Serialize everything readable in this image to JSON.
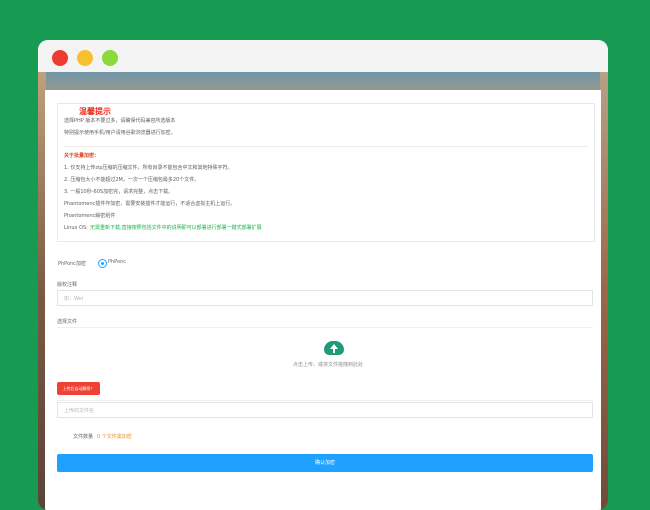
{
  "window": {
    "controls": {
      "close": "close-icon",
      "minimize": "minimize-icon",
      "zoom": "zoom-icon"
    }
  },
  "notice": {
    "title": "温馨提示",
    "intro": [
      "选择PHP 版本不要过多，请确保代码兼容所选版本",
      "特别提示使用手机/用户请用谷歌浏览器进行加密。"
    ],
    "about_title": "关于批量加密：",
    "items": [
      "1. 仅支持上传zip压缩的压缩文件，所有目录不能包含中文和其他特殊字符。",
      "2. 压缩包大小不能超过2M，一次一个压缩包最多20个文件。",
      "3. 一般10秒-60S加密完，请求完整，点击下载。",
      "Phantomenc插件作加密，需要安装插件才能运行，不适合虚拟主机上运行。",
      "Phantomenc解密组件"
    ],
    "linux_label": "Linux OS:",
    "linux_text": "无需重新下载,直接按照包括文件中的说明即可以部署进行部署一键式部署扩展"
  },
  "form": {
    "encrypt_label": "PhPonc加密",
    "encrypt_option": "PhPonc",
    "remark_label": "版权注释",
    "remark_placeholder": "如：Wei",
    "file_label": "选择文件",
    "upload_hint": "点击上传，或将文件拖拽到此处",
    "upload_badge": "上传后自动解密！",
    "filename_placeholder": "上传的文件名",
    "count_label": "文件数量",
    "count_value": "0 个文件需加密",
    "confirm_label": "确认加密"
  }
}
